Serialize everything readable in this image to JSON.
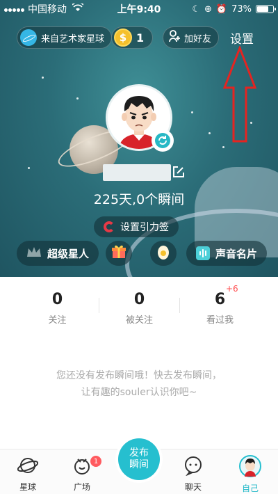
{
  "status_bar": {
    "carrier": "中国移动",
    "time": "上午9:40",
    "battery": "73%"
  },
  "header": {
    "planet_badge_label": "来自艺术家星球",
    "coin_count": "1",
    "add_friend_label": "加好友",
    "settings_label": "设置"
  },
  "profile": {
    "days_text": "225天,0个瞬间",
    "gravity_label": "设置引力签"
  },
  "action_buttons": {
    "super_star_label": "超级星人",
    "voice_card_label": "声音名片"
  },
  "stats": [
    {
      "value": "0",
      "label": "关注"
    },
    {
      "value": "0",
      "label": "被关注"
    },
    {
      "value": "6",
      "label": "看过我",
      "badge": "+6"
    }
  ],
  "empty_state": {
    "line1": "您还没有发布瞬间哦！快去发布瞬间，",
    "line2": "让有趣的souler认识你吧~"
  },
  "bottom_nav": {
    "items": [
      {
        "label": "星球",
        "icon": "planet-icon"
      },
      {
        "label": "广场",
        "icon": "square-icon",
        "badge": "1"
      },
      {
        "label": "聊天",
        "icon": "chat-icon"
      },
      {
        "label": "自己",
        "icon": "avatar-icon",
        "active": true
      }
    ],
    "publish_line1": "发布",
    "publish_line2": "瞬间"
  },
  "colors": {
    "accent": "#26bfcf",
    "hero_bg": "#2b6d78",
    "annotation_red": "#e52421",
    "badge_red": "#ff5a5f"
  }
}
